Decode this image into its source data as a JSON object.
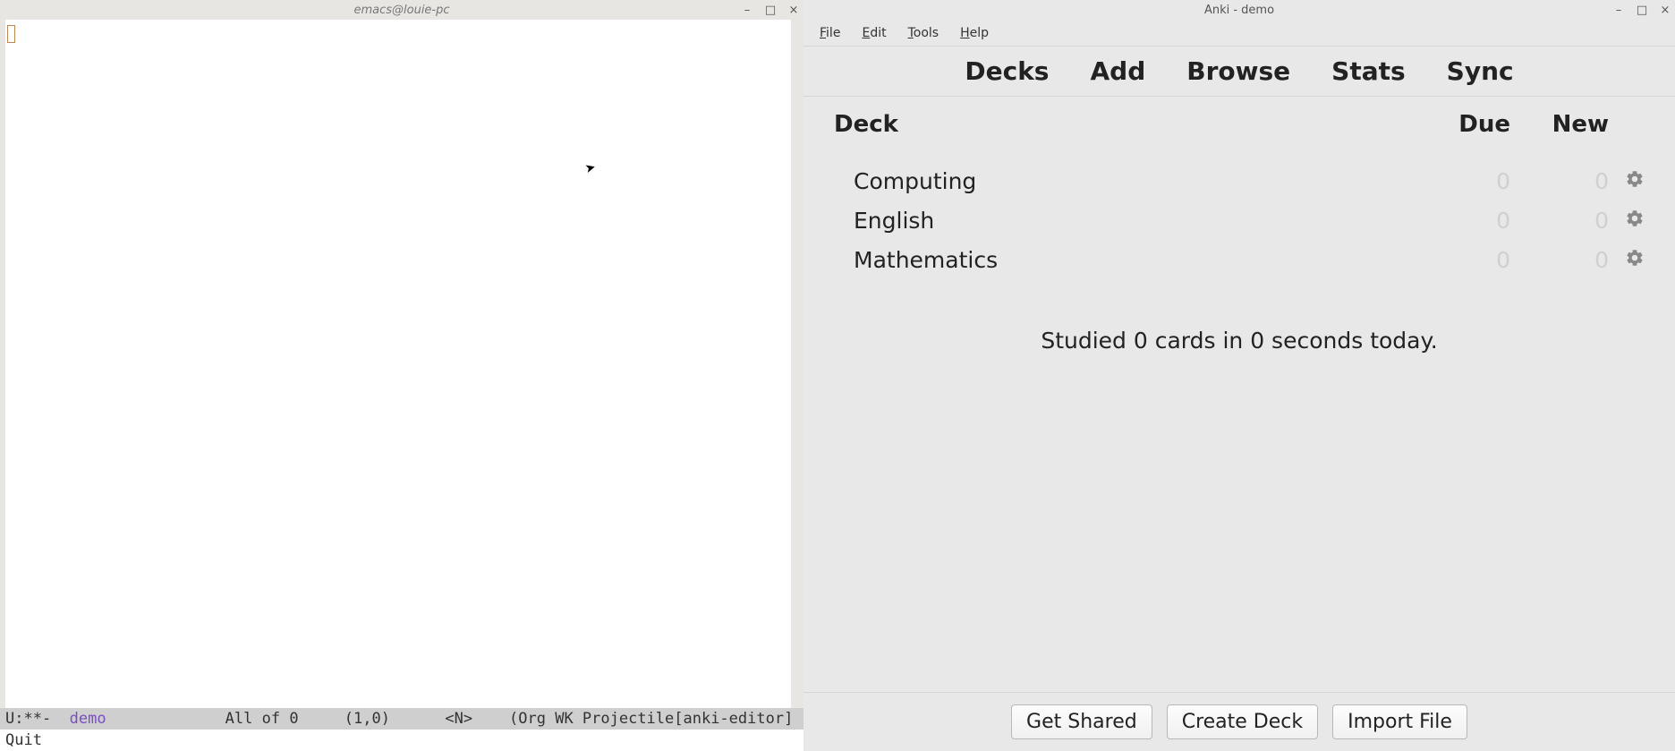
{
  "emacs": {
    "title": "emacs@louie-pc",
    "modeline": {
      "prefix": "U:**-  ",
      "buffer": "demo",
      "spacer1": "             ",
      "position": "All of 0",
      "spacer2": "     ",
      "cursor": "(1,0)",
      "spacer3": "      ",
      "state": "<N>",
      "spacer4": "    ",
      "modes": "(Org WK Projectile[anki-editor]"
    },
    "echo": "Quit"
  },
  "anki": {
    "title": "Anki - demo",
    "menu": {
      "file": "File",
      "edit": "Edit",
      "tools": "Tools",
      "help": "Help"
    },
    "tabs": {
      "decks": "Decks",
      "add": "Add",
      "browse": "Browse",
      "stats": "Stats",
      "sync": "Sync"
    },
    "columns": {
      "deck": "Deck",
      "due": "Due",
      "new": "New"
    },
    "decks": [
      {
        "name": "Computing",
        "due": "0",
        "new": "0"
      },
      {
        "name": "English",
        "due": "0",
        "new": "0"
      },
      {
        "name": "Mathematics",
        "due": "0",
        "new": "0"
      }
    ],
    "status": "Studied 0 cards in 0 seconds today.",
    "buttons": {
      "get_shared": "Get Shared",
      "create_deck": "Create Deck",
      "import_file": "Import File"
    }
  }
}
